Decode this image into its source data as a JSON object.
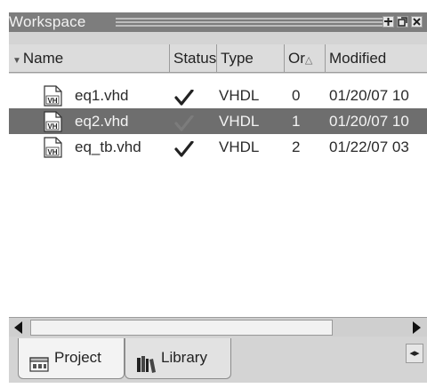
{
  "window": {
    "title": "Workspace"
  },
  "columns": [
    {
      "label": "Name"
    },
    {
      "label": "Status"
    },
    {
      "label": "Type"
    },
    {
      "label": "Or"
    },
    {
      "label": "Modified"
    }
  ],
  "files": [
    {
      "icon": "vhdl-file-icon",
      "icon_text": "VH",
      "name": "eq1.vhd",
      "status": "compiled-check-icon",
      "type": "VHDL",
      "order": "0",
      "modified": "01/20/07 10",
      "selected": false
    },
    {
      "icon": "vhdl-file-icon",
      "icon_text": "VH",
      "name": "eq2.vhd",
      "status": "compiled-check-icon",
      "type": "VHDL",
      "order": "1",
      "modified": "01/20/07 10",
      "selected": true
    },
    {
      "icon": "vhdl-file-icon",
      "icon_text": "VH",
      "name": "eq_tb.vhd",
      "status": "compiled-check-icon",
      "type": "VHDL",
      "order": "2",
      "modified": "01/22/07 03",
      "selected": false
    }
  ],
  "tabs": [
    {
      "label": "Project",
      "icon": "project-icon",
      "active": true
    },
    {
      "label": "Library",
      "icon": "library-icon",
      "active": false
    }
  ],
  "colors": {
    "titlebar": "#7d7d7d",
    "selection": "#6e6e6e",
    "panel": "#d4d4d4"
  }
}
